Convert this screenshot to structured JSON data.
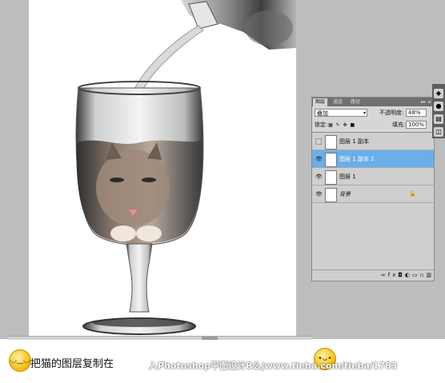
{
  "panel": {
    "tabs": [
      "图层",
      "通道",
      "路径"
    ],
    "menu": "▸▸ ≡",
    "blend_mode": "叠加",
    "opacity_label": "不透明度:",
    "opacity_value": "48%",
    "lock_label": "锁定:",
    "fill_label": "填充:",
    "fill_value": "100%",
    "layers": [
      {
        "name": "图层 1 副本",
        "visible": false,
        "selected": false
      },
      {
        "name": "图层 1 副本 2",
        "visible": true,
        "selected": true
      },
      {
        "name": "图层 1",
        "visible": true,
        "selected": false
      },
      {
        "name": "背景",
        "visible": true,
        "selected": false,
        "locked": true
      }
    ]
  },
  "caption": {
    "text": "把猫的图层复制在",
    "watermark": "入Photoshop平面设计B么|www.tieba.com/tieba/1783"
  },
  "colors": {
    "workspace": "#bdbdbd",
    "selection": "#6aaeea"
  },
  "icons": [
    "eye-icon",
    "lock-icon",
    "smiley-emoticon-icon",
    "layer-thumbnail-icon"
  ]
}
